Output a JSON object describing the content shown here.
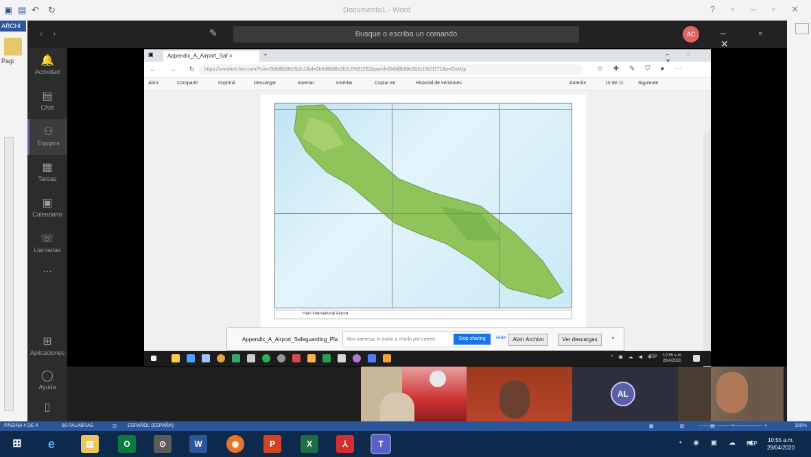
{
  "word": {
    "title": "Documento1 - Word",
    "archive_tab": "ARCHI",
    "page_label": "Pagi",
    "quick_access": [
      "💾",
      "↶",
      "↷"
    ]
  },
  "teams": {
    "search_placeholder": "Busque o escriba un comando",
    "avatar_initials": "AC",
    "rail": [
      {
        "label": "Actividad",
        "icon": "bell-icon"
      },
      {
        "label": "Chat",
        "icon": "chat-icon"
      },
      {
        "label": "Equipos",
        "icon": "teams-icon"
      },
      {
        "label": "Tareas",
        "icon": "assignments-icon"
      },
      {
        "label": "Calendario",
        "icon": "calendar-icon"
      },
      {
        "label": "Llamadas",
        "icon": "phone-icon"
      },
      {
        "label": "...",
        "icon": "more-icon"
      },
      {
        "label": "Aplicaciones",
        "icon": "apps-icon"
      },
      {
        "label": "Ayuda",
        "icon": "help-icon"
      }
    ],
    "participant_initials": "AL"
  },
  "browser": {
    "tab_title": "Appendix_A_Airport_Saf",
    "url": "https://onedrive.live.com/?cid=2b6d8b08e2b2c1&id=2b6d8b08e2b2c1%21252&parId=2b6d8b08e2b2c1%21171&o=OneUp",
    "toolbar": {
      "open": "Abrir",
      "share": "Compartir",
      "print": "Imprimir",
      "download": "Descargar",
      "embed": "Insertar",
      "rename": "Insertar",
      "copy": "Copiar en",
      "history": "Historial de versiones",
      "prev": "Anterior",
      "page": "10 de 11",
      "next": "Siguiente"
    },
    "pdf_caption": "Hato International Airport"
  },
  "download_bar": {
    "filename": "Appendix_A_Airport_Safeguarding_Pla",
    "message": "Nos interesa, te invito a charla por correo",
    "share_button": "Stop sharing",
    "hide": "Hide",
    "open_button": "Abrir Archivo",
    "view_button": "Ver descargas",
    "close": "×"
  },
  "inner_taskbar": {
    "clock_time": "10:55 a.m.",
    "clock_date": "29/4/2020",
    "lang": "ESP"
  },
  "status_bar": {
    "page": "PÁGINA 4 DE 4",
    "words": "89 PALABRAS",
    "language": "ESPAÑOL (ESPAÑA)",
    "zoom": "100%"
  },
  "taskbar": {
    "apps": [
      {
        "name": "internet-explorer-icon",
        "label": "e",
        "color": "#1e90ff"
      },
      {
        "name": "file-explorer-icon",
        "label": "▤",
        "color": "#e8c75d"
      },
      {
        "name": "outlook-icon",
        "label": "O",
        "color": "#0a7b3e"
      },
      {
        "name": "clock-app-icon",
        "label": "⊙",
        "color": "#5b5b5b"
      },
      {
        "name": "word-icon",
        "label": "W",
        "color": "#2b579a"
      },
      {
        "name": "firefox-icon",
        "label": "◉",
        "color": "#e8742a"
      },
      {
        "name": "powerpoint-icon",
        "label": "P",
        "color": "#d04424"
      },
      {
        "name": "excel-icon",
        "label": "X",
        "color": "#1d6f42"
      },
      {
        "name": "acrobat-icon",
        "label": "⅄",
        "color": "#d32f2f"
      },
      {
        "name": "teams-taskbar-icon",
        "label": "T",
        "color": "#5b5fc7"
      }
    ],
    "lang": "ESP",
    "time": "10:55 a.m.",
    "date": "29/04/2020"
  }
}
